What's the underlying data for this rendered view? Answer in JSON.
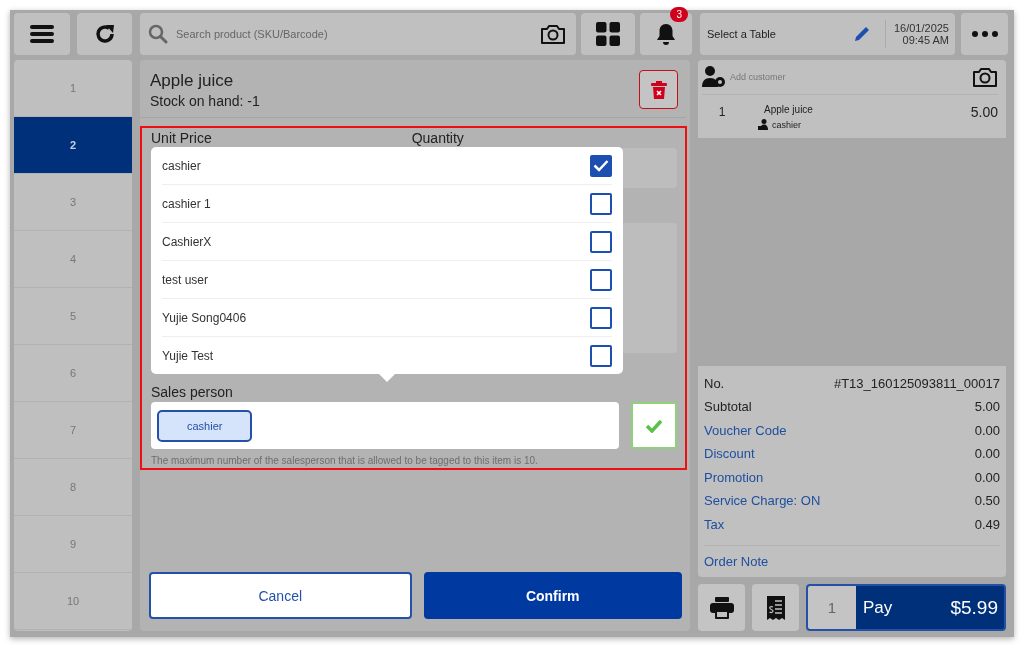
{
  "toolbar": {
    "search": {
      "placeholder": "Search product (SKU/Barcode)"
    },
    "notifications": {
      "badge": "3"
    }
  },
  "table_bar": {
    "label": "Select a Table",
    "date": "16/01/2025",
    "time": "09:45 AM"
  },
  "tables": [
    {
      "label": "1",
      "selected": false
    },
    {
      "label": "2",
      "selected": true
    },
    {
      "label": "3",
      "selected": false
    },
    {
      "label": "4",
      "selected": false
    },
    {
      "label": "5",
      "selected": false
    },
    {
      "label": "6",
      "selected": false
    },
    {
      "label": "7",
      "selected": false
    },
    {
      "label": "8",
      "selected": false
    },
    {
      "label": "9",
      "selected": false
    },
    {
      "label": "10",
      "selected": false
    }
  ],
  "item_editor": {
    "title": "Apple juice",
    "stock": "Stock on hand: -1",
    "unit_price_label": "Unit Price",
    "quantity_label": "Quantity",
    "salesperson_label": "Sales person",
    "salesperson_chips": [
      "cashier"
    ],
    "hint": "The maximum number of the salesperson that is allowed to be tagged to this item is 10.",
    "cancel": "Cancel",
    "confirm": "Confirm"
  },
  "salesperson_dropdown": [
    {
      "name": "cashier",
      "checked": true
    },
    {
      "name": "cashier 1",
      "checked": false
    },
    {
      "name": "CashierX",
      "checked": false
    },
    {
      "name": "test user",
      "checked": false
    },
    {
      "name": "Yujie Song0406",
      "checked": false
    },
    {
      "name": "Yujie Test",
      "checked": false
    }
  ],
  "order": {
    "customer_placeholder": "Add customer",
    "items": [
      {
        "qty": "1",
        "name": "Apple juice",
        "price": "5.00",
        "salesperson": "cashier"
      }
    ],
    "summary": [
      {
        "label": "No.",
        "value": "#T13_160125093811_00017",
        "kind": "plain"
      },
      {
        "label": "Subtotal",
        "value": "5.00",
        "kind": "plain"
      },
      {
        "label": "Voucher Code",
        "value": "0.00",
        "kind": "link"
      },
      {
        "label": "Discount",
        "value": "0.00",
        "kind": "link"
      },
      {
        "label": "Promotion",
        "value": "0.00",
        "kind": "link"
      },
      {
        "label": "Service Charge: ON",
        "value": "0.50",
        "kind": "link"
      },
      {
        "label": "Tax",
        "value": "0.49",
        "kind": "link"
      }
    ],
    "order_note": "Order Note",
    "pay": {
      "count": "1",
      "label": "Pay",
      "amount": "$5.99"
    }
  }
}
